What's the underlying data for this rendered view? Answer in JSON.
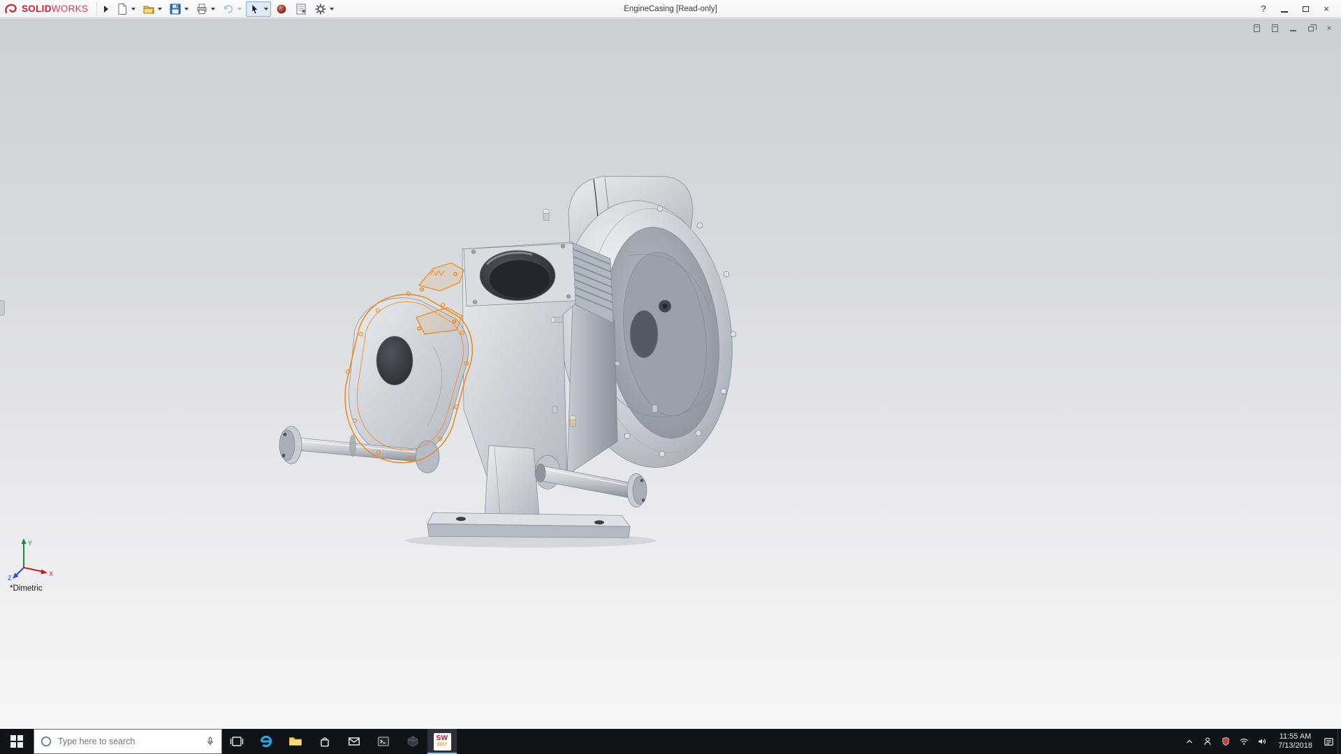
{
  "colors": {
    "accent_red": "#cf1f2c",
    "selection_orange": "#f08c1a",
    "taskbar_bg": "#101418",
    "viewport_gradient_top": "#ccd0d5",
    "viewport_gradient_bottom": "#f5f6f7"
  },
  "titlebar": {
    "logo": {
      "bold": "SOLID",
      "light": "WORKS"
    },
    "document_title": "EngineCasing [Read-only]",
    "help_glyph": "?",
    "close_glyph": "×",
    "icon_names": [
      "solidworks-logo",
      "flyout-expand-arrow",
      "new-document-icon",
      "open-document-icon",
      "save-icon",
      "print-icon",
      "undo-icon",
      "select-cursor-icon",
      "appearances-sphere-icon",
      "options-form-icon",
      "settings-gear-icon",
      "help-icon",
      "minimize-icon",
      "maximize-icon",
      "close-icon"
    ]
  },
  "viewport": {
    "orientation_label": "*Dimetric",
    "selected_sketch_color": "#f08c1a",
    "doc_controls": {
      "close_glyph": "×"
    },
    "triad": {
      "x": "X",
      "y": "Y",
      "z": "Z"
    }
  },
  "taskbar": {
    "search": {
      "placeholder": "Type here to search"
    },
    "solidworks_badge": {
      "top": "SW",
      "year": "2017"
    },
    "clock": {
      "time": "11:55 AM",
      "date": "7/13/2018"
    },
    "icon_names": [
      "windows-start-icon",
      "cortana-circle-icon",
      "microphone-icon",
      "task-view-icon",
      "edge-icon",
      "file-explorer-icon",
      "store-icon",
      "mail-icon",
      "console-icon",
      "3d-viewer-icon",
      "solidworks-app-icon",
      "tray-chevron-icon",
      "people-icon",
      "shield-icon",
      "wifi-icon",
      "volume-icon",
      "action-center-icon"
    ]
  }
}
